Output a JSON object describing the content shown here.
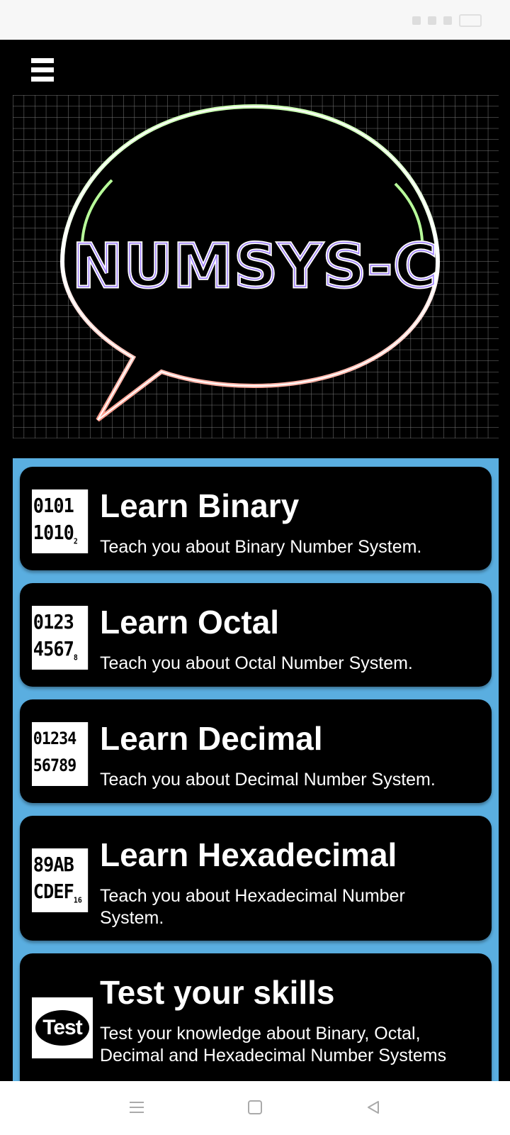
{
  "app": {
    "logo_text": "NUMSYS-C"
  },
  "menu": [
    {
      "title": "Learn Binary",
      "description": "Teach you about Binary Number System.",
      "icon_lines": [
        "0101",
        "1010"
      ],
      "icon_subscript": "2",
      "icon": "binary-digits-icon"
    },
    {
      "title": "Learn Octal",
      "description": "Teach you about Octal Number System.",
      "icon_lines": [
        "0123",
        "4567"
      ],
      "icon_subscript": "8",
      "icon": "octal-digits-icon"
    },
    {
      "title": "Learn Decimal",
      "description": "Teach you about Decimal Number System.",
      "icon_lines": [
        "01234",
        "56789"
      ],
      "icon_subscript": "",
      "icon": "decimal-digits-icon"
    },
    {
      "title": "Learn Hexadecimal",
      "description": "Teach you about Hexadecimal Number System.",
      "icon_lines": [
        "89AB",
        "CDEF"
      ],
      "icon_subscript": "16",
      "icon": "hexadecimal-digits-icon"
    },
    {
      "title": "Test your skills",
      "description": "Test your knowledge about Binary, Octal, Decimal and Hexadecimal Number Systems",
      "icon_text": "Test",
      "icon": "test-speech-bubble-icon"
    }
  ],
  "colors": {
    "panel": "#5aaee0",
    "card": "#000000",
    "text": "#ffffff"
  },
  "nav": [
    "recent-apps-icon",
    "home-icon",
    "back-icon"
  ]
}
